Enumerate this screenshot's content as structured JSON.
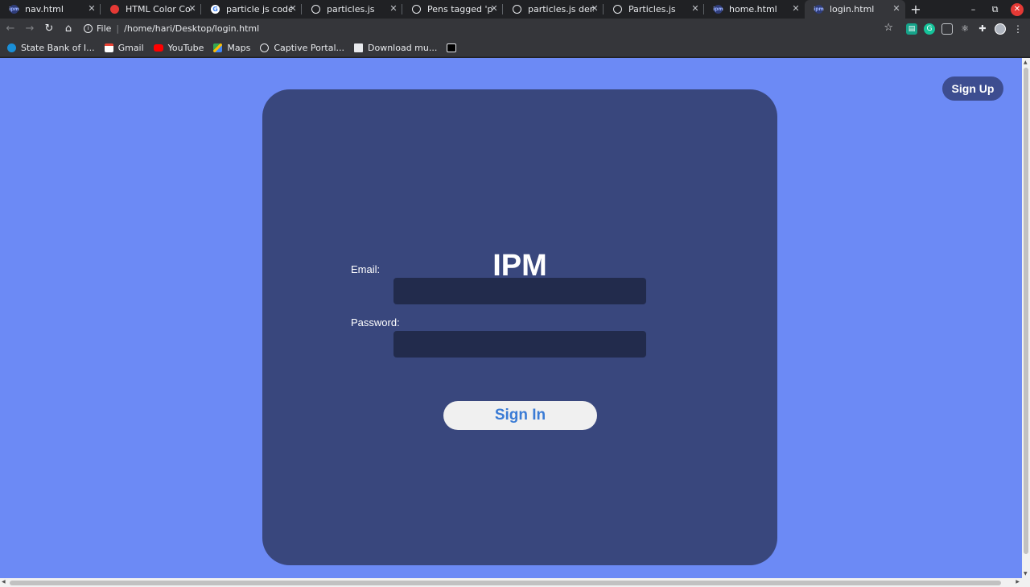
{
  "tabs": [
    {
      "title": "nav.html",
      "icon": "ipm-favicon-icon",
      "active": false
    },
    {
      "title": "HTML Color Codes",
      "icon": "html-color-favicon-icon",
      "active": false
    },
    {
      "title": "particle js codepen",
      "icon": "google-favicon-icon",
      "active": false
    },
    {
      "title": "particles.js",
      "icon": "codepen-favicon-icon",
      "active": false
    },
    {
      "title": "Pens tagged 'particles'",
      "icon": "codepen-favicon-icon",
      "active": false
    },
    {
      "title": "particles.js demo",
      "icon": "codepen-favicon-icon",
      "active": false
    },
    {
      "title": "Particles.js",
      "icon": "codepen-favicon-icon",
      "active": false
    },
    {
      "title": "home.html",
      "icon": "ipm-favicon-icon",
      "active": false
    },
    {
      "title": "login.html",
      "icon": "ipm-favicon-icon",
      "active": true
    }
  ],
  "omnibox": {
    "scheme": "File",
    "url": "/home/hari/Desktop/login.html"
  },
  "bookmarks": [
    {
      "label": "State Bank of I...",
      "icon": "sbi-icon"
    },
    {
      "label": "Gmail",
      "icon": "gmail-icon"
    },
    {
      "label": "YouTube",
      "icon": "youtube-icon"
    },
    {
      "label": "Maps",
      "icon": "maps-icon"
    },
    {
      "label": "Captive Portal...",
      "icon": "captive-portal-icon"
    },
    {
      "label": "Download mu...",
      "icon": "download-icon"
    },
    {
      "label": "",
      "icon": "m-bookmark-icon"
    }
  ],
  "page": {
    "signup_label": "Sign Up",
    "title": "IPM",
    "email_label": "Email:",
    "email_value": "",
    "password_label": "Password:",
    "password_value": "",
    "signin_label": "Sign In"
  },
  "colors": {
    "page_bg": "#6c8af5",
    "card_bg": "#39477d",
    "input_bg": "#222b4c",
    "signin_text": "#3a7bd5"
  }
}
